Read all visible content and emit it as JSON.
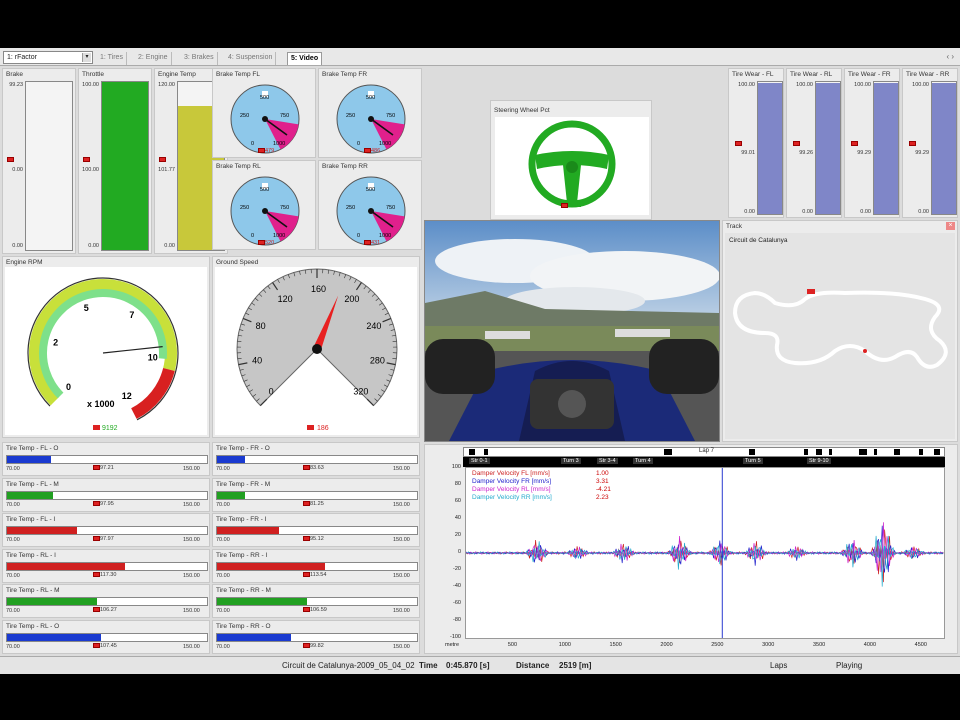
{
  "app": {
    "profile": "1: rFactor",
    "tabs": [
      "1: Tires",
      "2: Engine",
      "3: Brakes",
      "4: Suspension",
      "5: Video"
    ],
    "active_tab": 4,
    "tab_nav": "‹ ›"
  },
  "vbars": [
    {
      "title": "Brake",
      "top": "99.23",
      "mid": "0.00",
      "bottom": "0.00",
      "level": 0.0,
      "color": "#ffffff"
    },
    {
      "title": "Throttle",
      "top": "100.00",
      "mid": "100.00",
      "bottom": "0.00",
      "level": 1.0,
      "color": "#22aa22"
    },
    {
      "title": "Engine Temp",
      "top": "120.00",
      "mid": "101.77",
      "bottom": "0.00",
      "level": 0.86,
      "color": "#c8c83a"
    }
  ],
  "brake_temps": [
    {
      "title": "Brake Temp FL",
      "value": "479",
      "min": "250",
      "max": "750",
      "low": "0",
      "high": "1000",
      "center": "500"
    },
    {
      "title": "Brake Temp FR",
      "value": "486",
      "min": "250",
      "max": "750",
      "low": "0",
      "high": "1000",
      "center": "500"
    },
    {
      "title": "Brake Temp RL",
      "value": "520",
      "min": "250",
      "max": "750",
      "low": "0",
      "high": "1000",
      "center": "500"
    },
    {
      "title": "Brake Temp RR",
      "value": "431",
      "min": "250",
      "max": "750",
      "low": "0",
      "high": "1000",
      "center": "500"
    }
  ],
  "steering": {
    "title": "Steering Wheel Pct",
    "value": "5.01"
  },
  "tire_wear": [
    {
      "title": "Tire Wear - FL",
      "top": "100.00",
      "mid": "99.01",
      "bottom": "0.00",
      "level": 0.99
    },
    {
      "title": "Tire Wear - RL",
      "top": "100.00",
      "mid": "99.26",
      "bottom": "0.00",
      "level": 0.99
    },
    {
      "title": "Tire Wear - FR",
      "top": "100.00",
      "mid": "99.29",
      "bottom": "0.00",
      "level": 0.99
    },
    {
      "title": "Tire Wear - RR",
      "top": "100.00",
      "mid": "99.29",
      "bottom": "0.00",
      "level": 0.99
    }
  ],
  "rpm": {
    "title": "Engine RPM",
    "ticks": [
      "0",
      "2",
      "5",
      "7",
      "10",
      "12"
    ],
    "unit": "x 1000",
    "value": "9192",
    "fraction": 0.76
  },
  "speed": {
    "title": "Ground Speed",
    "ticks": [
      "0",
      "40",
      "80",
      "120",
      "160",
      "200",
      "240",
      "280",
      "320"
    ],
    "value": "186",
    "fraction": 0.58
  },
  "track": {
    "title": "Track",
    "name": "Circuit de Catalunya",
    "close": "×"
  },
  "tire_temps": [
    {
      "title": "Tire Temp - FL - O",
      "min": "70.00",
      "val": "97.21",
      "max": "150.00",
      "level": 0.22,
      "color": "#1a3ad0"
    },
    {
      "title": "Tire Temp - FR - O",
      "min": "70.00",
      "val": "83.63",
      "max": "150.00",
      "level": 0.14,
      "color": "#1a3ad0"
    },
    {
      "title": "Tire Temp - FL - M",
      "min": "70.00",
      "val": "97.95",
      "max": "150.00",
      "level": 0.23,
      "color": "#22a022"
    },
    {
      "title": "Tire Temp - FR - M",
      "min": "70.00",
      "val": "81.25",
      "max": "150.00",
      "level": 0.14,
      "color": "#22a022"
    },
    {
      "title": "Tire Temp - FL - I",
      "min": "70.00",
      "val": "97.97",
      "max": "150.00",
      "level": 0.35,
      "color": "#d02020"
    },
    {
      "title": "Tire Temp - FR - I",
      "min": "70.00",
      "val": "95.12",
      "max": "150.00",
      "level": 0.31,
      "color": "#d02020"
    },
    {
      "title": "Tire Temp - RL - I",
      "min": "70.00",
      "val": "117.30",
      "max": "150.00",
      "level": 0.59,
      "color": "#d02020"
    },
    {
      "title": "Tire Temp - RR - I",
      "min": "70.00",
      "val": "113.54",
      "max": "150.00",
      "level": 0.54,
      "color": "#d02020"
    },
    {
      "title": "Tire Temp - RL - M",
      "min": "70.00",
      "val": "106.27",
      "max": "150.00",
      "level": 0.45,
      "color": "#22a022"
    },
    {
      "title": "Tire Temp - RR - M",
      "min": "70.00",
      "val": "106.59",
      "max": "150.00",
      "level": 0.45,
      "color": "#22a022"
    },
    {
      "title": "Tire Temp - RL - O",
      "min": "70.00",
      "val": "107.45",
      "max": "150.00",
      "level": 0.47,
      "color": "#1a3ad0"
    },
    {
      "title": "Tire Temp - RR - O",
      "min": "70.00",
      "val": "99.82",
      "max": "150.00",
      "level": 0.37,
      "color": "#1a3ad0"
    }
  ],
  "lap_strip": {
    "lap": "Lap 7",
    "segments": [
      "Str 0-1",
      "Turn 3",
      "Str 3-4",
      "Turn 4",
      "Turn 5",
      "Str 9-10"
    ]
  },
  "chart_data": {
    "type": "line",
    "xlabel": "metre",
    "ylim": [
      -100,
      100
    ],
    "xlim": [
      0,
      4700
    ],
    "yticks": [
      "100",
      "80",
      "60",
      "40",
      "20",
      "0",
      "-20",
      "-40",
      "-60",
      "-80",
      "-100"
    ],
    "xticks": [
      "500",
      "1000",
      "1500",
      "2000",
      "2500",
      "3000",
      "3500",
      "4000",
      "4500"
    ],
    "cursor_x": 2520,
    "series": [
      {
        "name": "Damper Velocity FL [mm/s]",
        "value": "1.00",
        "color": "#cc2222"
      },
      {
        "name": "Damper Velocity FR [mm/s]",
        "value": "3.31",
        "color": "#2222cc"
      },
      {
        "name": "Damper Velocity RL [mm/s]",
        "value": "-4.21",
        "color": "#cc22cc"
      },
      {
        "name": "Damper Velocity RR [mm/s]",
        "value": "2.23",
        "color": "#22aacc"
      }
    ]
  },
  "status": {
    "session": "Circuit de Catalunya-2009_05_04_02",
    "time_label": "Time",
    "time": "0:45.870 [s]",
    "distance_label": "Distance",
    "distance": "2519 [m]",
    "laps": "Laps",
    "state": "Playing"
  }
}
